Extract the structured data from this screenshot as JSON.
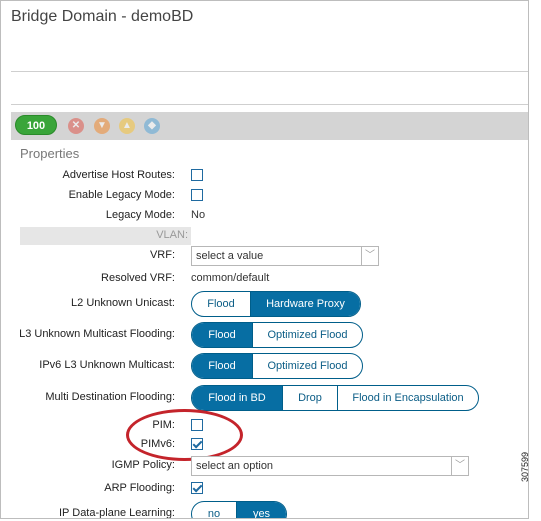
{
  "window": {
    "title": "Bridge Domain - demoBD"
  },
  "health": {
    "score": "100",
    "fault_icons": [
      "critical-fault-icon",
      "major-fault-icon",
      "minor-fault-icon",
      "warning-fault-icon"
    ],
    "fault_colors": [
      "#e05a4f",
      "#f08a32",
      "#f5c33b",
      "#5aa5d6"
    ]
  },
  "properties": {
    "section_title": "Properties",
    "advertise_host_routes": {
      "label": "Advertise Host Routes:",
      "checked": false
    },
    "enable_legacy_mode": {
      "label": "Enable Legacy Mode:",
      "checked": false
    },
    "legacy_mode": {
      "label": "Legacy Mode:",
      "value": "No"
    },
    "vlan": {
      "label": "VLAN:"
    },
    "vrf": {
      "label": "VRF:",
      "value": "select a value"
    },
    "resolved_vrf": {
      "label": "Resolved VRF:",
      "value": "common/default"
    },
    "l2_unknown_unicast": {
      "label": "L2 Unknown Unicast:",
      "options": [
        "Flood",
        "Hardware Proxy"
      ],
      "selected": "Hardware Proxy"
    },
    "l3_unknown_multicast": {
      "label": "L3 Unknown Multicast Flooding:",
      "options": [
        "Flood",
        "Optimized Flood"
      ],
      "selected": "Flood"
    },
    "ipv6_l3_unknown_multicast": {
      "label": "IPv6 L3 Unknown Multicast:",
      "options": [
        "Flood",
        "Optimized Flood"
      ],
      "selected": "Flood"
    },
    "multi_destination_flooding": {
      "label": "Multi Destination Flooding:",
      "options": [
        "Flood in BD",
        "Drop",
        "Flood in Encapsulation"
      ],
      "selected": "Flood in BD"
    },
    "pim": {
      "label": "PIM:",
      "checked": false
    },
    "pimv6": {
      "label": "PIMv6:",
      "checked": true
    },
    "igmp_policy": {
      "label": "IGMP Policy:",
      "value": "select an option"
    },
    "arp_flooding": {
      "label": "ARP Flooding:",
      "checked": true
    },
    "ip_dataplane_learning": {
      "label": "IP Data-plane Learning:",
      "options": [
        "no",
        "yes"
      ],
      "selected": "yes"
    }
  },
  "figure_id": "307599",
  "colors": {
    "accent": "#076ea3",
    "health_green": "#3aa53a",
    "highlight_circle": "#c4242b"
  }
}
